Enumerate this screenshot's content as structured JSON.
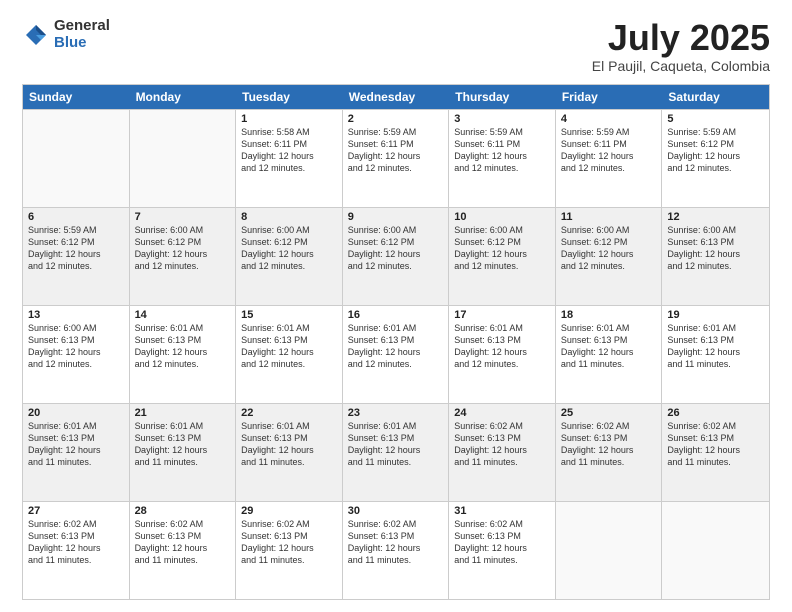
{
  "header": {
    "logo_general": "General",
    "logo_blue": "Blue",
    "month_title": "July 2025",
    "location": "El Paujil, Caqueta, Colombia"
  },
  "weekdays": [
    "Sunday",
    "Monday",
    "Tuesday",
    "Wednesday",
    "Thursday",
    "Friday",
    "Saturday"
  ],
  "rows": [
    [
      {
        "day": "",
        "info": ""
      },
      {
        "day": "",
        "info": ""
      },
      {
        "day": "1",
        "info": "Sunrise: 5:58 AM\nSunset: 6:11 PM\nDaylight: 12 hours\nand 12 minutes."
      },
      {
        "day": "2",
        "info": "Sunrise: 5:59 AM\nSunset: 6:11 PM\nDaylight: 12 hours\nand 12 minutes."
      },
      {
        "day": "3",
        "info": "Sunrise: 5:59 AM\nSunset: 6:11 PM\nDaylight: 12 hours\nand 12 minutes."
      },
      {
        "day": "4",
        "info": "Sunrise: 5:59 AM\nSunset: 6:11 PM\nDaylight: 12 hours\nand 12 minutes."
      },
      {
        "day": "5",
        "info": "Sunrise: 5:59 AM\nSunset: 6:12 PM\nDaylight: 12 hours\nand 12 minutes."
      }
    ],
    [
      {
        "day": "6",
        "info": "Sunrise: 5:59 AM\nSunset: 6:12 PM\nDaylight: 12 hours\nand 12 minutes."
      },
      {
        "day": "7",
        "info": "Sunrise: 6:00 AM\nSunset: 6:12 PM\nDaylight: 12 hours\nand 12 minutes."
      },
      {
        "day": "8",
        "info": "Sunrise: 6:00 AM\nSunset: 6:12 PM\nDaylight: 12 hours\nand 12 minutes."
      },
      {
        "day": "9",
        "info": "Sunrise: 6:00 AM\nSunset: 6:12 PM\nDaylight: 12 hours\nand 12 minutes."
      },
      {
        "day": "10",
        "info": "Sunrise: 6:00 AM\nSunset: 6:12 PM\nDaylight: 12 hours\nand 12 minutes."
      },
      {
        "day": "11",
        "info": "Sunrise: 6:00 AM\nSunset: 6:12 PM\nDaylight: 12 hours\nand 12 minutes."
      },
      {
        "day": "12",
        "info": "Sunrise: 6:00 AM\nSunset: 6:13 PM\nDaylight: 12 hours\nand 12 minutes."
      }
    ],
    [
      {
        "day": "13",
        "info": "Sunrise: 6:00 AM\nSunset: 6:13 PM\nDaylight: 12 hours\nand 12 minutes."
      },
      {
        "day": "14",
        "info": "Sunrise: 6:01 AM\nSunset: 6:13 PM\nDaylight: 12 hours\nand 12 minutes."
      },
      {
        "day": "15",
        "info": "Sunrise: 6:01 AM\nSunset: 6:13 PM\nDaylight: 12 hours\nand 12 minutes."
      },
      {
        "day": "16",
        "info": "Sunrise: 6:01 AM\nSunset: 6:13 PM\nDaylight: 12 hours\nand 12 minutes."
      },
      {
        "day": "17",
        "info": "Sunrise: 6:01 AM\nSunset: 6:13 PM\nDaylight: 12 hours\nand 12 minutes."
      },
      {
        "day": "18",
        "info": "Sunrise: 6:01 AM\nSunset: 6:13 PM\nDaylight: 12 hours\nand 11 minutes."
      },
      {
        "day": "19",
        "info": "Sunrise: 6:01 AM\nSunset: 6:13 PM\nDaylight: 12 hours\nand 11 minutes."
      }
    ],
    [
      {
        "day": "20",
        "info": "Sunrise: 6:01 AM\nSunset: 6:13 PM\nDaylight: 12 hours\nand 11 minutes."
      },
      {
        "day": "21",
        "info": "Sunrise: 6:01 AM\nSunset: 6:13 PM\nDaylight: 12 hours\nand 11 minutes."
      },
      {
        "day": "22",
        "info": "Sunrise: 6:01 AM\nSunset: 6:13 PM\nDaylight: 12 hours\nand 11 minutes."
      },
      {
        "day": "23",
        "info": "Sunrise: 6:01 AM\nSunset: 6:13 PM\nDaylight: 12 hours\nand 11 minutes."
      },
      {
        "day": "24",
        "info": "Sunrise: 6:02 AM\nSunset: 6:13 PM\nDaylight: 12 hours\nand 11 minutes."
      },
      {
        "day": "25",
        "info": "Sunrise: 6:02 AM\nSunset: 6:13 PM\nDaylight: 12 hours\nand 11 minutes."
      },
      {
        "day": "26",
        "info": "Sunrise: 6:02 AM\nSunset: 6:13 PM\nDaylight: 12 hours\nand 11 minutes."
      }
    ],
    [
      {
        "day": "27",
        "info": "Sunrise: 6:02 AM\nSunset: 6:13 PM\nDaylight: 12 hours\nand 11 minutes."
      },
      {
        "day": "28",
        "info": "Sunrise: 6:02 AM\nSunset: 6:13 PM\nDaylight: 12 hours\nand 11 minutes."
      },
      {
        "day": "29",
        "info": "Sunrise: 6:02 AM\nSunset: 6:13 PM\nDaylight: 12 hours\nand 11 minutes."
      },
      {
        "day": "30",
        "info": "Sunrise: 6:02 AM\nSunset: 6:13 PM\nDaylight: 12 hours\nand 11 minutes."
      },
      {
        "day": "31",
        "info": "Sunrise: 6:02 AM\nSunset: 6:13 PM\nDaylight: 12 hours\nand 11 minutes."
      },
      {
        "day": "",
        "info": ""
      },
      {
        "day": "",
        "info": ""
      }
    ]
  ]
}
